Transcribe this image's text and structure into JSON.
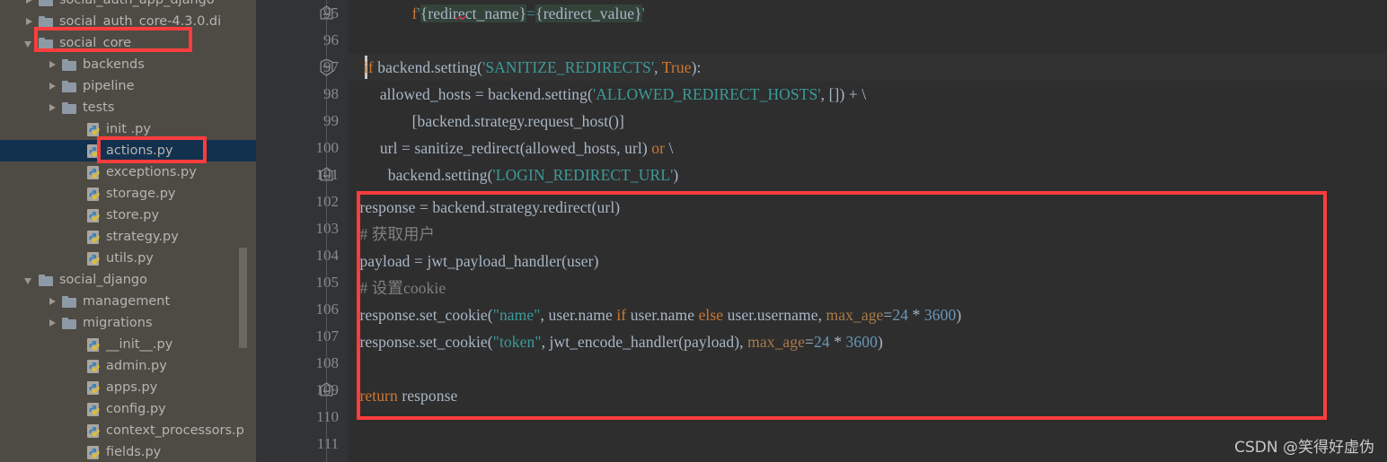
{
  "sidebar": {
    "scrollbar": {
      "present": true
    },
    "items": [
      {
        "label": "social_auth_app_django",
        "type": "folder",
        "arrow": "closed",
        "indent": 52,
        "selected": false,
        "clipped_top": true
      },
      {
        "label": "social_auth_core-4.3.0.di",
        "type": "folder",
        "arrow": "closed",
        "indent": 52,
        "selected": false
      },
      {
        "label": "social_core",
        "type": "folder",
        "arrow": "open",
        "indent": 52,
        "selected": false,
        "annotated": true
      },
      {
        "label": "backends",
        "type": "folder",
        "arrow": "closed",
        "indent": 78,
        "selected": false
      },
      {
        "label": "pipeline",
        "type": "folder",
        "arrow": "closed",
        "indent": 78,
        "selected": false
      },
      {
        "label": "tests",
        "type": "folder",
        "arrow": "closed",
        "indent": 78,
        "selected": false
      },
      {
        "label": "init .py",
        "type": "py",
        "arrow": "none",
        "indent": 105,
        "selected": false
      },
      {
        "label": "actions.py",
        "type": "py",
        "arrow": "none",
        "indent": 105,
        "selected": true,
        "annotated": true
      },
      {
        "label": "exceptions.py",
        "type": "py",
        "arrow": "none",
        "indent": 105,
        "selected": false
      },
      {
        "label": "storage.py",
        "type": "py",
        "arrow": "none",
        "indent": 105,
        "selected": false
      },
      {
        "label": "store.py",
        "type": "py",
        "arrow": "none",
        "indent": 105,
        "selected": false
      },
      {
        "label": "strategy.py",
        "type": "py",
        "arrow": "none",
        "indent": 105,
        "selected": false
      },
      {
        "label": "utils.py",
        "type": "py",
        "arrow": "none",
        "indent": 105,
        "selected": false
      },
      {
        "label": "social_django",
        "type": "folder",
        "arrow": "open",
        "indent": 52,
        "selected": false
      },
      {
        "label": "management",
        "type": "folder",
        "arrow": "closed",
        "indent": 78,
        "selected": false
      },
      {
        "label": "migrations",
        "type": "folder",
        "arrow": "closed",
        "indent": 78,
        "selected": false
      },
      {
        "label": "__init__.py",
        "type": "py",
        "arrow": "none",
        "indent": 105,
        "selected": false
      },
      {
        "label": "admin.py",
        "type": "py",
        "arrow": "none",
        "indent": 105,
        "selected": false
      },
      {
        "label": "apps.py",
        "type": "py",
        "arrow": "none",
        "indent": 105,
        "selected": false
      },
      {
        "label": "config.py",
        "type": "py",
        "arrow": "none",
        "indent": 105,
        "selected": false
      },
      {
        "label": "context_processors.p",
        "type": "py",
        "arrow": "none",
        "indent": 105,
        "selected": false
      },
      {
        "label": "fields.py",
        "type": "py",
        "arrow": "none",
        "indent": 105,
        "selected": false
      }
    ]
  },
  "editor": {
    "line_numbers": [
      "95",
      "96",
      "97",
      "98",
      "99",
      "100",
      "101",
      "102",
      "103",
      "104",
      "105",
      "106",
      "107",
      "108",
      "109",
      "110",
      "111"
    ],
    "current_line": "97",
    "fold_markers": [
      {
        "line": "95",
        "state": "collapsed-minus"
      },
      {
        "line": "97",
        "state": "expanded-minus"
      },
      {
        "line": "101",
        "state": "collapsed-minus"
      },
      {
        "line": "109",
        "state": "collapsed-minus"
      }
    ],
    "lines": [
      {
        "num": "95",
        "text": "                f'{redirect_name}={redirect_value}'"
      },
      {
        "num": "96",
        "text": ""
      },
      {
        "num": "97",
        "text": "        if backend.setting('SANITIZE_REDIRECTS', True):"
      },
      {
        "num": "98",
        "text": "            allowed_hosts = backend.setting('ALLOWED_REDIRECT_HOSTS', []) + \\"
      },
      {
        "num": "99",
        "text": "                        [backend.strategy.request_host()]"
      },
      {
        "num": "100",
        "text": "            url = sanitize_redirect(allowed_hosts, url) or \\"
      },
      {
        "num": "101",
        "text": "                backend.setting('LOGIN_REDIRECT_URL')"
      },
      {
        "num": "102",
        "text": "    response = backend.strategy.redirect(url)"
      },
      {
        "num": "103",
        "text": "    # 获取用户"
      },
      {
        "num": "104",
        "text": "    payload = jwt_payload_handler(user)"
      },
      {
        "num": "105",
        "text": "    # 设置cookie"
      },
      {
        "num": "106",
        "text": "    response.set_cookie(\"name\", user.name if user.name else user.username, max_age=24 * 3600)"
      },
      {
        "num": "107",
        "text": "    response.set_cookie(\"token\", jwt_encode_handler(payload), max_age=24 * 3600)"
      },
      {
        "num": "108",
        "text": ""
      },
      {
        "num": "109",
        "text": "    return response"
      },
      {
        "num": "110",
        "text": ""
      },
      {
        "num": "111",
        "text": ""
      }
    ],
    "tokens": {
      "f_prefix": "f",
      "quote": "'",
      "redirect_name": "redirect_name",
      "redirect_value": "redirect_value",
      "if": "if",
      "backend_setting": "backend.setting(",
      "sanitize_redirects": "'SANITIZE_REDIRECTS'",
      "true": "True",
      "allowed_hosts_assign": "allowed_hosts = backend.setting(",
      "allowed_redirect_hosts": "'ALLOWED_REDIRECT_HOSTS'",
      "request_host": "[backend.strategy.request_host()]",
      "url_assign": "url = sanitize_redirect(allowed_hosts, url)",
      "or": "or",
      "login_redirect_url": "'LOGIN_REDIRECT_URL'",
      "response_assign": "response = backend.strategy.redirect(url)",
      "comment_get_user": "# 获取用户",
      "payload_assign": "payload = jwt_payload_handler(user)",
      "comment_set_cookie": "# 设置cookie",
      "set_cookie_name": "response.set_cookie(",
      "name_str": "\"name\"",
      "token_str": "\"token\"",
      "user_name_expr": "user.name",
      "else": "else",
      "user_username": "user.username,",
      "max_age": "max_age",
      "num_24": "24",
      "num_3600": "3600",
      "jwt_encode": "jwt_encode_handler(payload),",
      "return": "return",
      "response_var": "response"
    }
  },
  "annotations": {
    "boxes": [
      {
        "name": "social-core-highlight"
      },
      {
        "name": "actions-py-highlight"
      },
      {
        "name": "code-block-highlight"
      }
    ]
  },
  "watermark": {
    "text": "CSDN @笑得好虚伪"
  },
  "colors": {
    "sidebar_bg": "#4e4a44",
    "editor_bg": "#2e2e2e",
    "gutter_bg": "#313335",
    "selection_bg": "#12314e",
    "annotation_red": "#fc3d3d",
    "keyword_orange": "#cc7832",
    "string_teal": "#3d9a9a",
    "number_blue": "#6897bb",
    "comment_gray": "#808080",
    "text_default": "#a9b7c6",
    "fstring_highlight": "#34433a"
  }
}
